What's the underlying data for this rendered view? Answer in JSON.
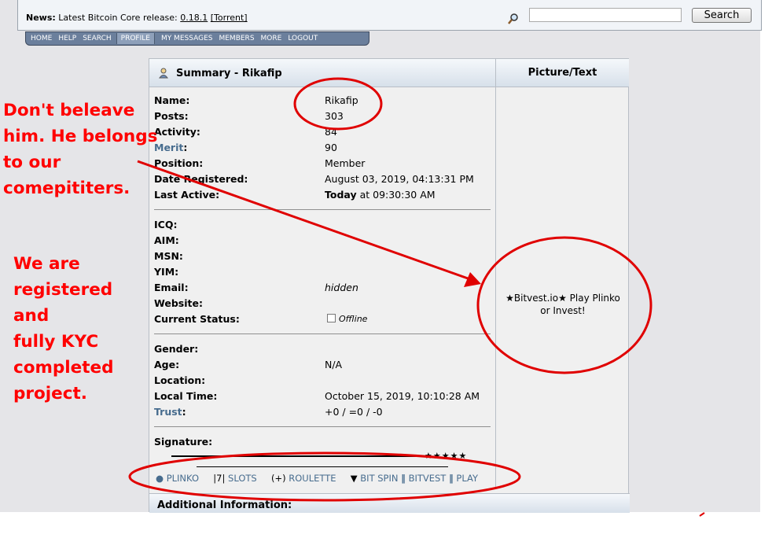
{
  "news": {
    "label": "News:",
    "text": "Latest Bitcoin Core release:",
    "version": "0.18.1",
    "torrent": "[Torrent]"
  },
  "search": {
    "button": "Search",
    "placeholder": ""
  },
  "menu": [
    "HOME",
    "HELP",
    "SEARCH",
    "PROFILE",
    "MY MESSAGES",
    "MEMBERS",
    "MORE",
    "LOGOUT"
  ],
  "profile": {
    "summary_title": "Summary - Rikafip",
    "picture_title": "Picture/Text",
    "picture_text_1": "★Bitvest.io★ Play Plinko",
    "picture_text_2": "or Invest!",
    "fields1": [
      {
        "label": "Name:",
        "value": "Rikafip"
      },
      {
        "label": "Posts:",
        "value": "303"
      },
      {
        "label": "Activity:",
        "value": "84"
      },
      {
        "label": "Merit",
        "value": "90"
      },
      {
        "label": "Position:",
        "value": "Member"
      },
      {
        "label": "Date Registered:",
        "value": "August 03, 2019, 04:13:31 PM"
      },
      {
        "label": "Last Active:",
        "value_bold": "Today",
        "value": " at 09:30:30 AM"
      }
    ],
    "merit_colon": ":",
    "fields2": [
      {
        "label": "ICQ:",
        "value": ""
      },
      {
        "label": "AIM:",
        "value": ""
      },
      {
        "label": "MSN:",
        "value": ""
      },
      {
        "label": "YIM:",
        "value": ""
      },
      {
        "label": "Email:",
        "value": "hidden"
      },
      {
        "label": "Website:",
        "value": ""
      },
      {
        "label": "Current Status:",
        "value": "Offline"
      }
    ],
    "fields3": [
      {
        "label": "Gender:",
        "value": ""
      },
      {
        "label": "Age:",
        "value": "N/A"
      },
      {
        "label": "Location:",
        "value": ""
      },
      {
        "label": "Local Time:",
        "value": "October 15, 2019, 10:10:28 AM"
      },
      {
        "label": "Trust",
        "value": "+0 / =0 / -0"
      }
    ],
    "trust_colon": ":",
    "signature_label": "Signature:",
    "signature_stars": "★★★★★",
    "signature_links": {
      "plinko": "● PLINKO",
      "slots_prefix": "|7|",
      "slots": "SLOTS",
      "roulette_prefix": "(+)",
      "roulette": "ROULETTE",
      "bitspin_prefix": "▼",
      "bitspin": "BIT SPIN",
      "bitvest": "BITVEST",
      "play": "PLAY",
      "divider": "‖"
    },
    "additional": "Additional Information:"
  },
  "annotations": {
    "warning": [
      "Don't beleave",
      "him. He belongs",
      "to our",
      "comepititers."
    ],
    "claim": [
      "We are",
      "registered",
      "and",
      "fully KYC",
      "completed",
      "project."
    ]
  },
  "colors": {
    "annotation": "#ff0000",
    "link": "#476c8e",
    "menu": "#6b7f9c"
  }
}
